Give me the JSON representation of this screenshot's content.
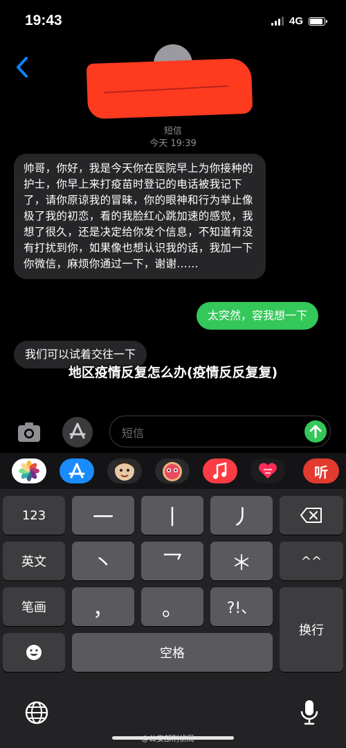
{
  "status_bar": {
    "time": "19:43",
    "network": "4G",
    "battery_level": 0.9
  },
  "header": {
    "service": "短信",
    "timestamp": "今天 19:39"
  },
  "messages": [
    {
      "direction": "incoming",
      "text": "帅哥，你好，我是今天你在医院早上为你接种的护士，你早上来打疫苗时登记的电话被我记下了，请你原谅我的冒昧，你的眼神和行为举止像极了我的初恋，看的我脸红心跳加速的感觉，我想了很久，还是决定给你发个信息，不知道有没有打扰到你，如果像也想认识我的话，我加一下你微信，麻烦你通过一下，谢谢……"
    },
    {
      "direction": "outgoing",
      "text": "太突然，容我想一下"
    },
    {
      "direction": "incoming",
      "text": "我们可以试着交往一下"
    }
  ],
  "overlay_caption": "地区疫情反复怎么办(疫情反反复复)",
  "input": {
    "placeholder": "短信"
  },
  "app_drawer": {
    "apps": [
      {
        "icon": "photos-app-icon",
        "color": "#ffffff"
      },
      {
        "icon": "app-store-icon",
        "color": "#1a8cff"
      },
      {
        "icon": "memoji-icon",
        "color": "#e9c9a3"
      },
      {
        "icon": "memoji-stickers-icon",
        "color": "#f4a6b8"
      },
      {
        "icon": "music-app-icon",
        "color": "#fc3c44"
      },
      {
        "icon": "digital-touch-icon",
        "color": "#1c1c1e"
      },
      {
        "icon": "listen-app-icon",
        "color": "#e23a2e",
        "label": "听"
      }
    ]
  },
  "keyboard": {
    "row1": [
      "123",
      "一",
      "丨",
      "丿"
    ],
    "row2": [
      "英文",
      "丶",
      "乛",
      "＊",
      "^^"
    ],
    "row3": [
      "笔画",
      "，",
      "。",
      "?!、"
    ],
    "return_label": "换行",
    "space_label": "空格"
  },
  "watermark": "@公安部刑侦局"
}
